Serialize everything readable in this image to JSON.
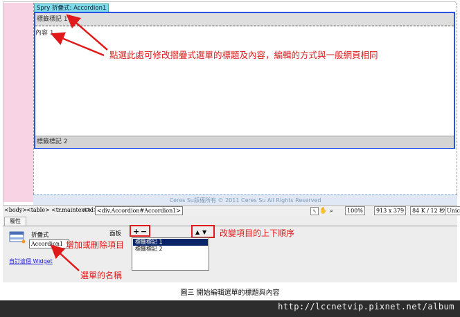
{
  "document": {
    "spry_tab": "Spry 折疊式: Accordion1",
    "accordion": {
      "panel1_label": "標籤標記 1",
      "panel1_content": "內容 1",
      "panel2_label": "標籤標記 2"
    },
    "footer_text": "Ceres Su版權所有 © 2011 Ceres Su All Rights Reserved"
  },
  "statusbar": {
    "tags": [
      "<body>",
      "<table>",
      "<tr.maintext>",
      "<td>"
    ],
    "selected_tag": "<div.Accordion#Accordion1>",
    "zoom": "100%",
    "window_size": "913 x 379",
    "file_info": "84 K / 12 秒",
    "encoding": "Unico"
  },
  "properties": {
    "tab_label": "屬性",
    "widget_type": "折疊式",
    "widget_name": "Accordion1",
    "panels_label": "面板",
    "add_symbol": "+",
    "remove_symbol": "−",
    "up_symbol": "▲",
    "down_symbol": "▼",
    "panels": [
      "標籤標記 1",
      "標籤標記 2"
    ],
    "customize_link": "自訂這個 Widget"
  },
  "annotations": {
    "edit_hint": "點選此處可修改摺疊式選單的標題及內容，編輯的方式與一般網頁相同",
    "add_remove": "增加或刪除項目",
    "reorder": "改變項目的上下順序",
    "menu_name": "選單的名稱"
  },
  "caption": "圖三  開始編輯選單的標題與內容",
  "url": "http://lccnetvip.pixnet.net/album",
  "colors": {
    "accordion_border": "#2a52e8",
    "annotation": "#e01a1a",
    "spry_tab": "#7fd9e8"
  }
}
